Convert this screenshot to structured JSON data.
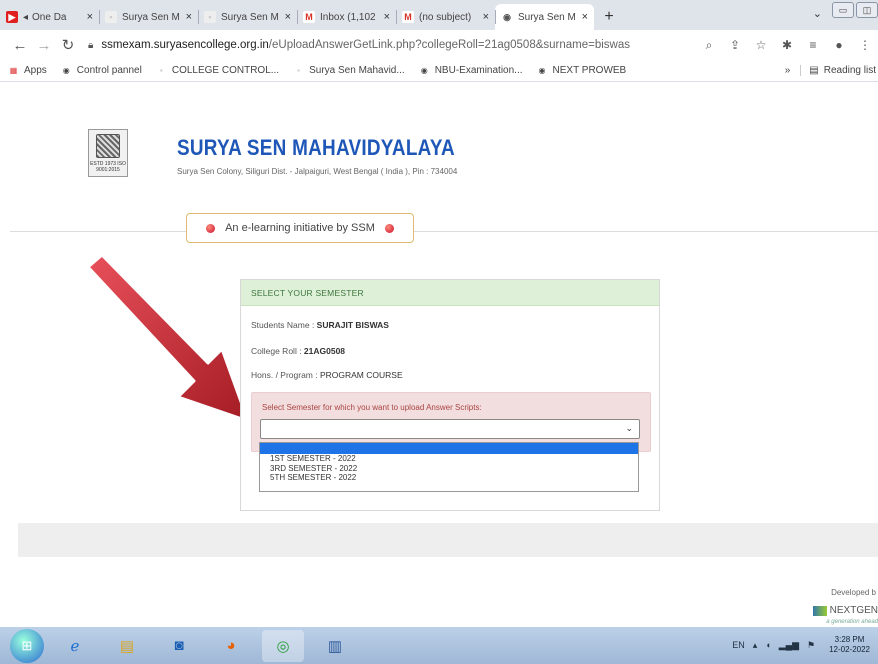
{
  "browser": {
    "tabs": [
      {
        "title": "One Da",
        "fav": "▶",
        "fav_color": "#e02020",
        "fav_text": "#fff",
        "extra": "◂"
      },
      {
        "title": "Surya Sen M",
        "fav": "▪",
        "fav_color": "#eee",
        "fav_text": "#ccc"
      },
      {
        "title": "Surya Sen M",
        "fav": "▪",
        "fav_color": "#eee",
        "fav_text": "#ccc"
      },
      {
        "title": "Inbox (1,102",
        "fav": "M",
        "fav_color": "#fff",
        "fav_text": "#d93025"
      },
      {
        "title": "(no subject)",
        "fav": "M",
        "fav_color": "#fff",
        "fav_text": "#d93025"
      },
      {
        "title": "Surya Sen M",
        "fav": "◉",
        "fav_color": "#fff",
        "fav_text": "#555",
        "active": true
      }
    ],
    "new_tab": "+",
    "url_host": "ssmexam.suryasencollege.org.in",
    "url_path": "/eUploadAnswerGetLink.php?collegeRoll=21ag0508&surname=biswas",
    "bookmarks": [
      "Apps",
      "Control pannel",
      "COLLEGE CONTROL...",
      "Surya Sen Mahavid...",
      "NBU-Examination...",
      "NEXT PROWEB"
    ],
    "reading_list": "Reading list",
    "more_bookmarks": "»"
  },
  "site": {
    "logo_text": "ESTD 1973 ISO 9001:2015",
    "title": "SURYA SEN MAHAVIDYALAYA",
    "address": "Surya Sen Colony, Siliguri Dist. - Jalpaiguri, West Bengal ( India ), Pin : 734004",
    "tagline": "An e-learning initiative by SSM"
  },
  "panel": {
    "heading": "SELECT YOUR SEMESTER",
    "student_label": "Students Name : ",
    "student_name": "SURAJIT BISWAS",
    "roll_label": "College Roll : ",
    "roll": "21AG0508",
    "program_label": "Hons. / Program : ",
    "program": "PROGRAM COURSE",
    "select_label": "Select Semester for which you want to upload Answer Scripts:",
    "select_value": "",
    "options": [
      "1ST SEMESTER - 2022",
      "3RD SEMESTER - 2022",
      "5TH SEMESTER - 2022"
    ]
  },
  "footer": {
    "developed_by": "Developed b",
    "dev_brand": "NEXTGEN",
    "dev_tag": "a generation ahead"
  },
  "taskbar": {
    "language": "EN",
    "time": "3:28 PM",
    "date": "12-02-2022"
  },
  "colors": {
    "title_blue": "#1e57b7",
    "panel_head_bg": "#dff0d8",
    "alert_bg": "#f2dede",
    "arrow_red": "#c0282e",
    "dropdown_highlight": "#1e73e6"
  }
}
